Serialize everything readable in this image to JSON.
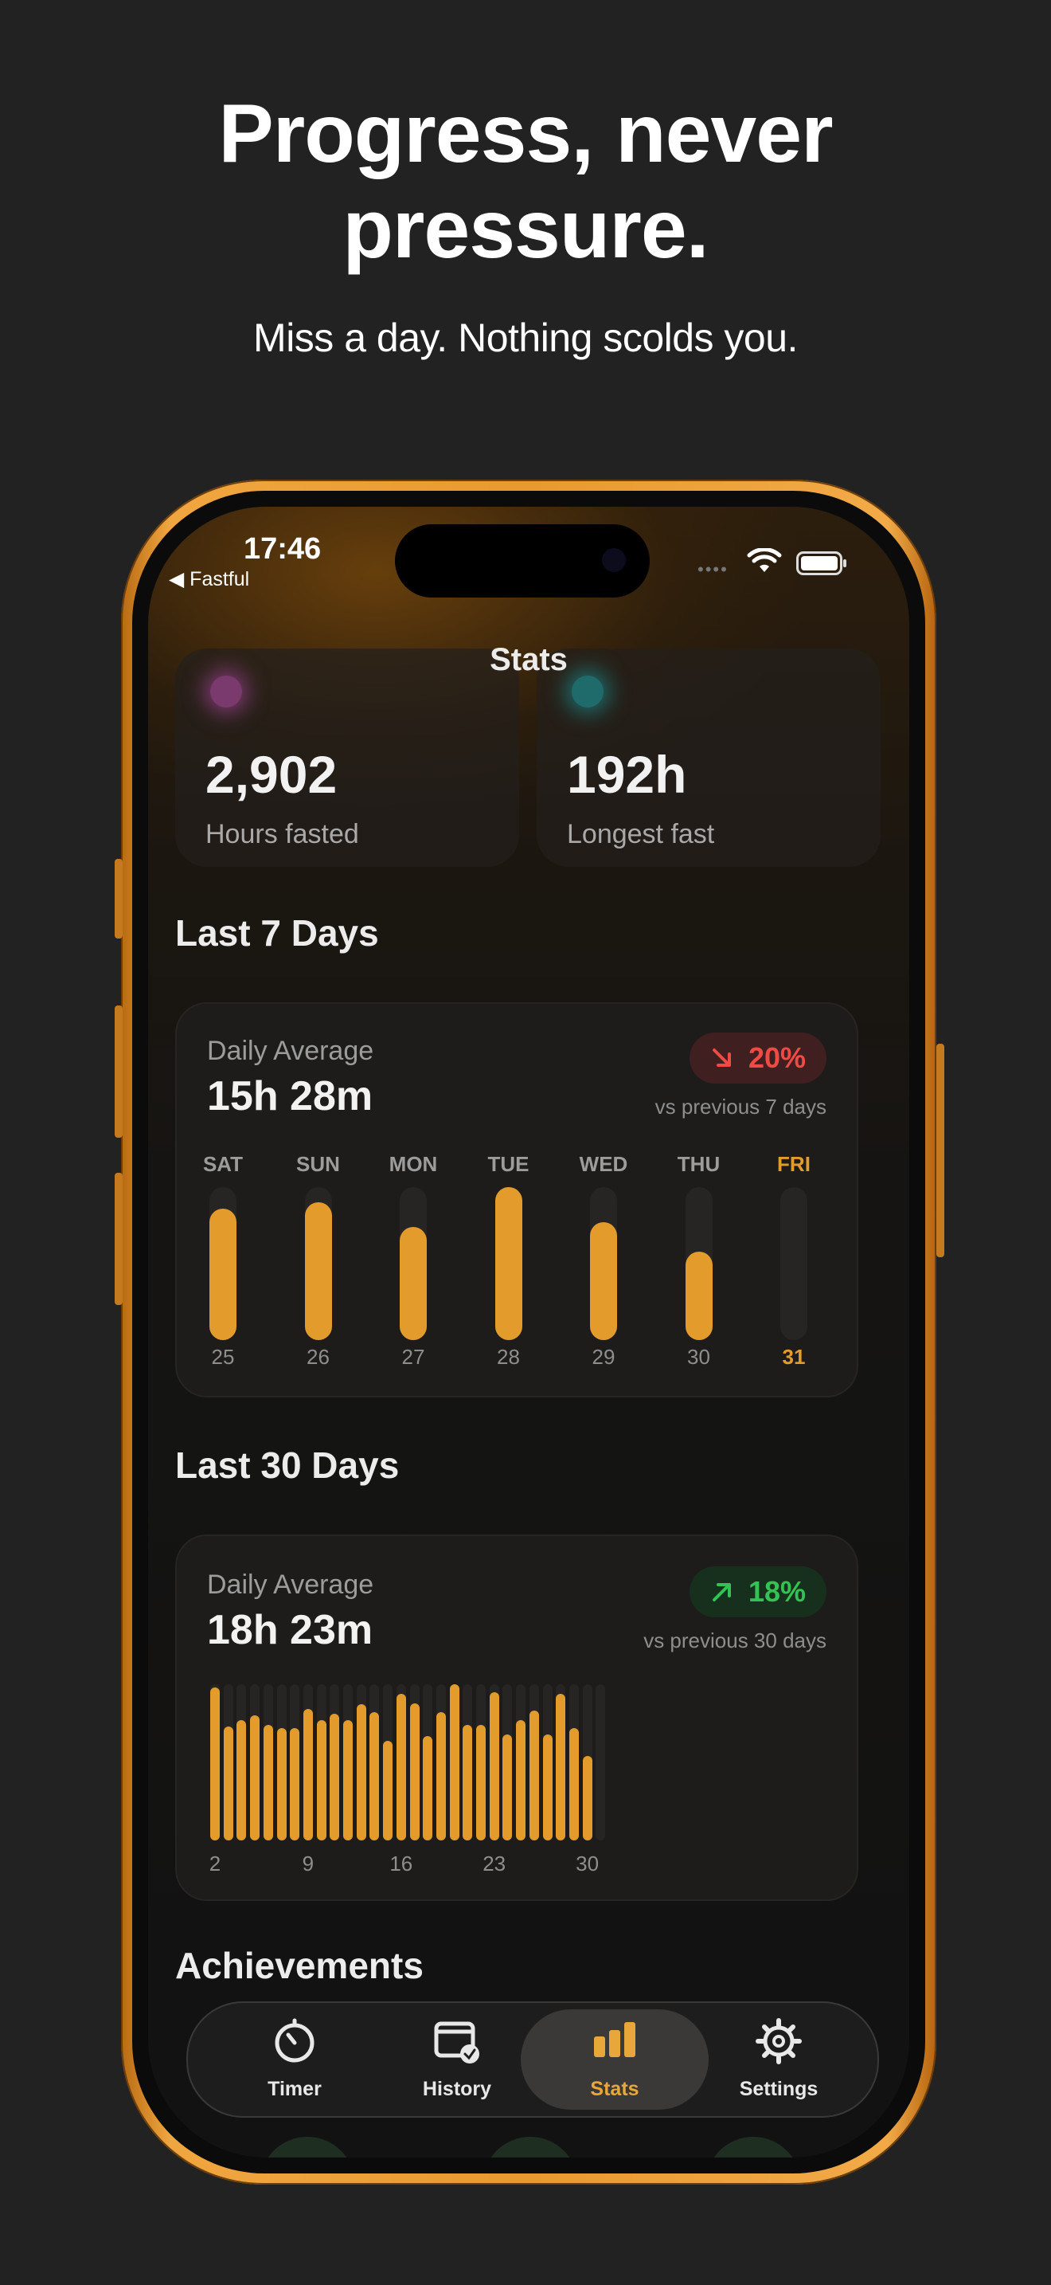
{
  "headline": {
    "line1": "Progress, never",
    "line2": "pressure."
  },
  "subline": "Miss a day. Nothing scolds you.",
  "status_bar": {
    "time": "17:46",
    "back_app": "◀ Fastful"
  },
  "nav_title": "Stats",
  "stat_cards": [
    {
      "value": "2,902",
      "label": "Hours fasted",
      "icon": "hourglass-icon",
      "icon_color": "#7a3a6e"
    },
    {
      "value": "192h",
      "label": "Longest fast",
      "icon": "stopwatch-icon",
      "icon_color": "#1f6b6b"
    }
  ],
  "week": {
    "title": "Last 7 Days",
    "subtitle": "Daily Average",
    "average": "15h 28m",
    "change": "20%",
    "change_direction": "down",
    "change_color": "#ef4a45",
    "comparison": "vs previous 7 days",
    "days": [
      {
        "day": "SAT",
        "date": "25",
        "fraction": 0.86
      },
      {
        "day": "SUN",
        "date": "26",
        "fraction": 0.9
      },
      {
        "day": "MON",
        "date": "27",
        "fraction": 0.74
      },
      {
        "day": "TUE",
        "date": "28",
        "fraction": 1.0
      },
      {
        "day": "WED",
        "date": "29",
        "fraction": 0.77
      },
      {
        "day": "THU",
        "date": "30",
        "fraction": 0.58
      },
      {
        "day": "FRI",
        "date": "31",
        "fraction": 0.0,
        "today": true
      }
    ]
  },
  "month": {
    "title": "Last 30 Days",
    "subtitle": "Daily Average",
    "average": "18h 23m",
    "change": "18%",
    "change_direction": "up",
    "change_color": "#35c254",
    "comparison": "vs previous 30 days",
    "axis_labels": [
      "2",
      "9",
      "16",
      "23",
      "30"
    ],
    "fractions": [
      0.98,
      0.73,
      0.77,
      0.8,
      0.74,
      0.72,
      0.72,
      0.84,
      0.77,
      0.81,
      0.77,
      0.87,
      0.82,
      0.64,
      0.94,
      0.88,
      0.67,
      0.82,
      1.0,
      0.74,
      0.74,
      0.95,
      0.68,
      0.77,
      0.83,
      0.68,
      0.94,
      0.72,
      0.54,
      0.0
    ]
  },
  "achievements_title": "Achievements",
  "tabs": [
    {
      "label": "Timer",
      "icon": "timer-icon"
    },
    {
      "label": "History",
      "icon": "calendar-check-icon"
    },
    {
      "label": "Stats",
      "icon": "bar-chart-icon",
      "active": true
    },
    {
      "label": "Settings",
      "icon": "gear-icon"
    }
  ],
  "accent_color": "#e39c2c"
}
